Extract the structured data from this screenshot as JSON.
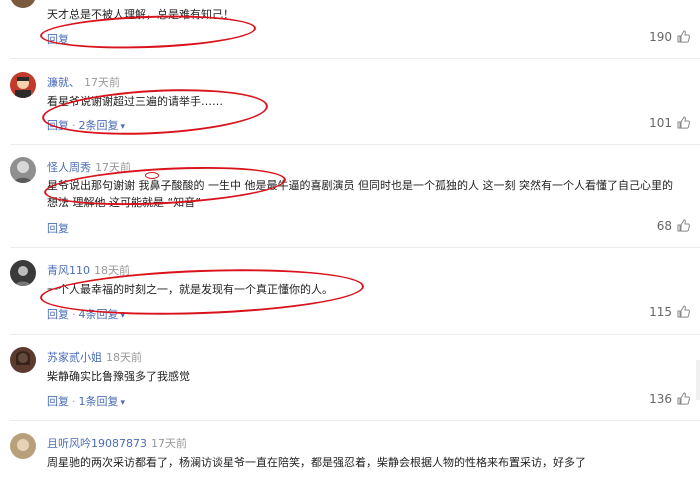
{
  "comments": [
    {
      "username": "",
      "time": "",
      "text": "天才总是不被人理解，总是难有知己！",
      "text2": "",
      "reply_label": "回复",
      "replies_label": "",
      "likes": "190"
    },
    {
      "username": "濂就、",
      "time": "17天前",
      "text": "看星爷说谢谢超过三遍的请举手……",
      "text2": "",
      "reply_label": "回复",
      "replies_label": "2条回复",
      "likes": "101"
    },
    {
      "username": "怪人周秀",
      "time": "17天前",
      "text": "星爷说出那句谢谢 我鼻子酸酸的 一生中 他是最牛逼的喜剧演员 但同时也是一个孤独的人 这一刻 突然有一个人看懂了自己心里的",
      "text2": "想法 理解他 这可能就是 “知音”",
      "reply_label": "回复",
      "replies_label": "",
      "likes": "68"
    },
    {
      "username": "青风110",
      "time": "18天前",
      "text": "一个人最幸福的时刻之一，就是发现有一个真正懂你的人。",
      "text2": "",
      "reply_label": "回复",
      "replies_label": "4条回复",
      "likes": "115"
    },
    {
      "username": "苏家贰小姐",
      "time": "18天前",
      "text": "柴静确实比鲁豫强多了我感觉",
      "text2": "",
      "reply_label": "回复",
      "replies_label": "1条回复",
      "likes": "136"
    },
    {
      "username": "且听风吟19087873",
      "time": "17天前",
      "text": "周星驰的两次采访都看了，杨澜访谈星爷一直在陪笑，都是强忍着，柴静会根据人物的性格来布置采访，好多了",
      "text2": "",
      "reply_label": "",
      "replies_label": "",
      "likes": ""
    }
  ],
  "icons": {
    "like": "thumbs-up-icon",
    "chevron": "chevron-down-icon"
  },
  "colors": {
    "link": "#4a6bb7",
    "annotation": "#d9121b"
  }
}
